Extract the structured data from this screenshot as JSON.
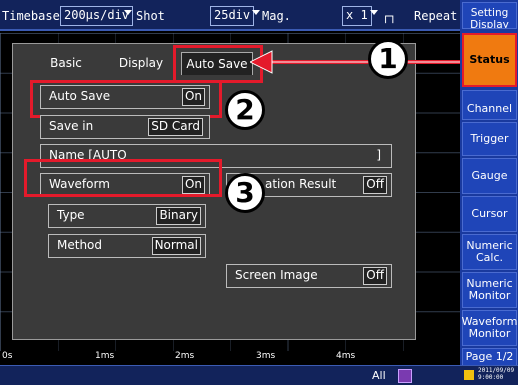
{
  "topbar": {
    "timebase_label": "Timebase",
    "timebase_value": "200µs/div",
    "shot_label": "Shot",
    "shot_value": "25div",
    "mag_label": "Mag.",
    "mag_value": "x 1",
    "trigger_mode": "Repeat"
  },
  "sidebar": {
    "setting": "Setting Display",
    "items": [
      "Status",
      "Channel",
      "Trigger",
      "Gauge",
      "Cursor",
      "Numeric Calc.",
      "Numeric Monitor",
      "Waveform Monitor",
      "Page 1/2"
    ]
  },
  "dialog": {
    "tabs": [
      "Basic",
      "Display",
      "Auto Save"
    ],
    "auto_save_label": "Auto Save",
    "auto_save_value": "On",
    "save_in_label": "Save in",
    "save_in_value": "SD Card",
    "name_label": "Name [AUTO",
    "name_end": "]",
    "waveform_label": "Waveform",
    "waveform_value": "On",
    "calc_result_label": "ation Result",
    "calc_result_value": "Off",
    "type_label": "Type",
    "type_value": "Binary",
    "method_label": "Method",
    "method_value": "Normal",
    "screen_image_label": "Screen Image",
    "screen_image_value": "Off"
  },
  "callouts": [
    "1",
    "2",
    "3"
  ],
  "axis": [
    "0s",
    "1ms",
    "2ms",
    "3ms",
    "4ms"
  ],
  "bottombar": {
    "all_label": "All",
    "datetime": "2011/09/09 9:00:00"
  },
  "colors": {
    "highlight": "#e41a2b",
    "status_active": "#f07a10",
    "sidebar_bg": "#1f45b8"
  }
}
